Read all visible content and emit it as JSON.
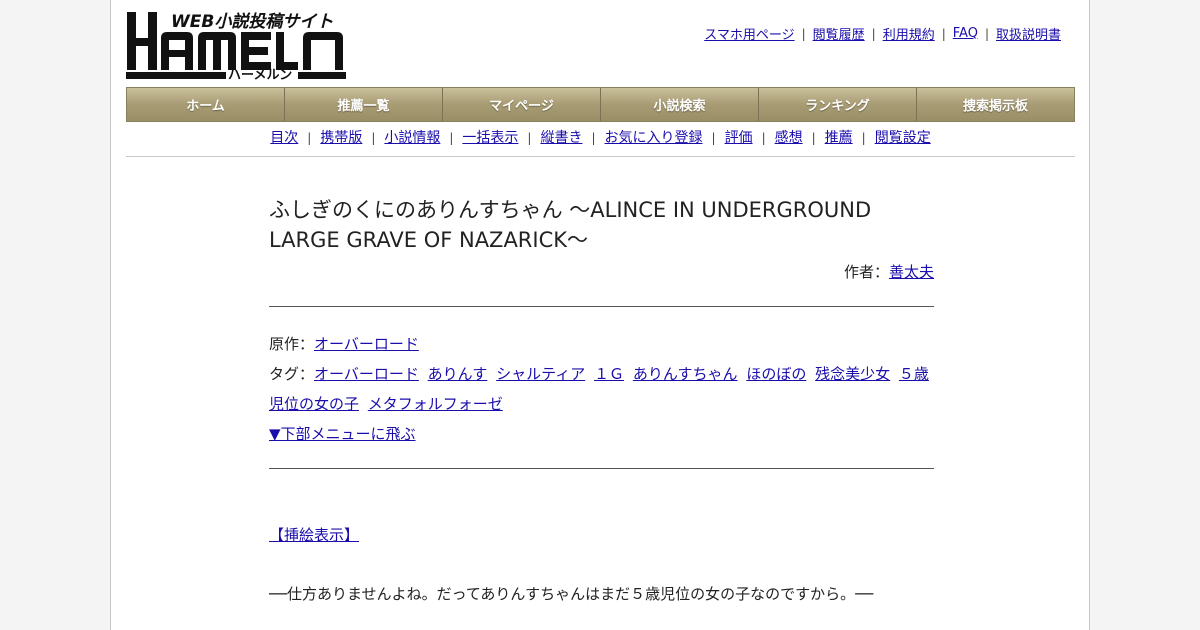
{
  "site": {
    "logo_main": "HAMELN",
    "logo_tagline": "WEB小説投稿サイト",
    "logo_kana": "ハーメルン"
  },
  "top_links": [
    "スマホ用ページ",
    "閲覧履歴",
    "利用規約",
    "FAQ",
    "取扱説明書"
  ],
  "main_nav": [
    "ホーム",
    "推薦一覧",
    "マイページ",
    "小説検索",
    "ランキング",
    "捜索掲示板"
  ],
  "sub_nav": [
    "目次",
    "携帯版",
    "小説情報",
    "一括表示",
    "縦書き",
    "お気に入り登録",
    "評価",
    "感想",
    "推薦",
    "閲覧設定"
  ],
  "novel": {
    "title": "ふしぎのくにのありんすちゃん ～ALINCE IN UNDERGROUND LARGE GRAVE OF NAZARICK～",
    "author_label": "作者：",
    "author": "善太夫",
    "original_label": "原作：",
    "original": "オーバーロード",
    "tags_label": "タグ：",
    "tags": [
      "オーバーロード",
      "ありんす",
      "シャルティア",
      "１Ｇ",
      "ありんすちゃん",
      "ほのぼの",
      "残念美少女",
      "５歳児位の女の子",
      "メタフォルフォーゼ"
    ],
    "jump_link": "▼下部メニューに飛ぶ",
    "illust_link": "【挿絵表示】",
    "first_line": "──仕方ありませんよね。だってありんすちゃんはまだ５歳児位の女の子なのですから。──"
  },
  "colors": {
    "nav_gold": "#a89c74",
    "link": "#1a0dab",
    "page_bg": "#f4f4f4"
  }
}
